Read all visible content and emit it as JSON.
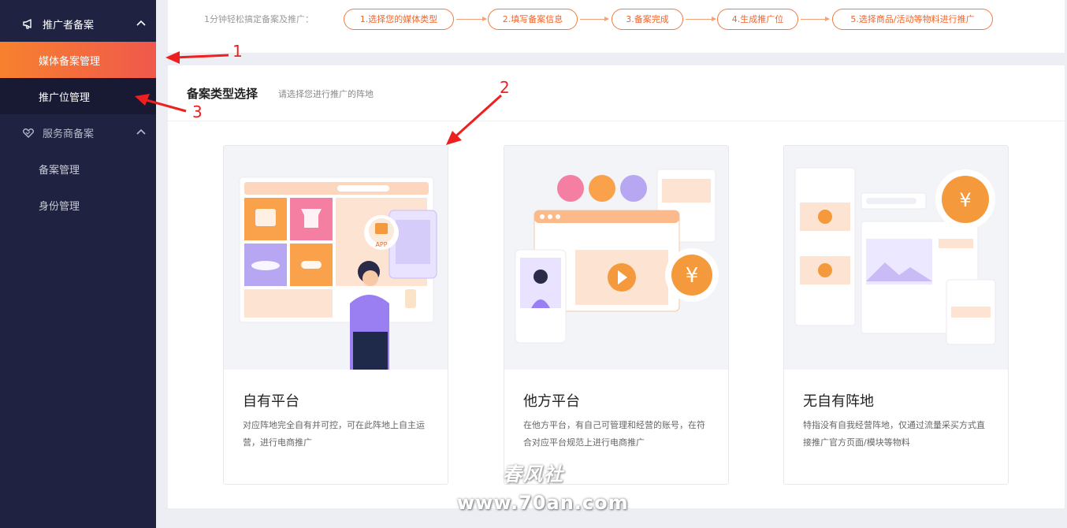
{
  "sidebar": {
    "group1": {
      "label": "推广者备案",
      "icon": "megaphone-icon"
    },
    "items1": [
      {
        "label": "媒体备案管理"
      },
      {
        "label": "推广位管理"
      }
    ],
    "group2": {
      "label": "服务商备案",
      "icon": "handshake-icon"
    },
    "items2": [
      {
        "label": "备案管理"
      },
      {
        "label": "身份管理"
      }
    ]
  },
  "steps": {
    "intro": "1分钟轻松搞定备案及推广：",
    "items": [
      "1.选择您的媒体类型",
      "2.填写备案信息",
      "3.备案完成",
      "4.生成推广位",
      "5.选择商品/活动等物料进行推广"
    ]
  },
  "panel": {
    "title": "备案类型选择",
    "subtitle": "请选择您进行推广的阵地",
    "cards": [
      {
        "title": "自有平台",
        "desc": "对应阵地完全自有并可控，可在此阵地上自主运营，进行电商推广",
        "art_text": "APP"
      },
      {
        "title": "他方平台",
        "desc": "在他方平台，有自己可管理和经营的账号，在符合对应平台规范上进行电商推广",
        "art_text": "¥"
      },
      {
        "title": "无自有阵地",
        "desc": "特指没有自我经营阵地，仅通过流量采买方式直接推广官方页面/模块等物料",
        "art_text": "¥"
      }
    ]
  },
  "annotations": [
    "1",
    "2",
    "3"
  ],
  "watermark": {
    "line1": "春风社",
    "line2": "www.70an.com"
  },
  "colors": {
    "sidebar_bg": "#1f2240",
    "accent": "#f17a45",
    "annotation": "#ee1f1f"
  }
}
